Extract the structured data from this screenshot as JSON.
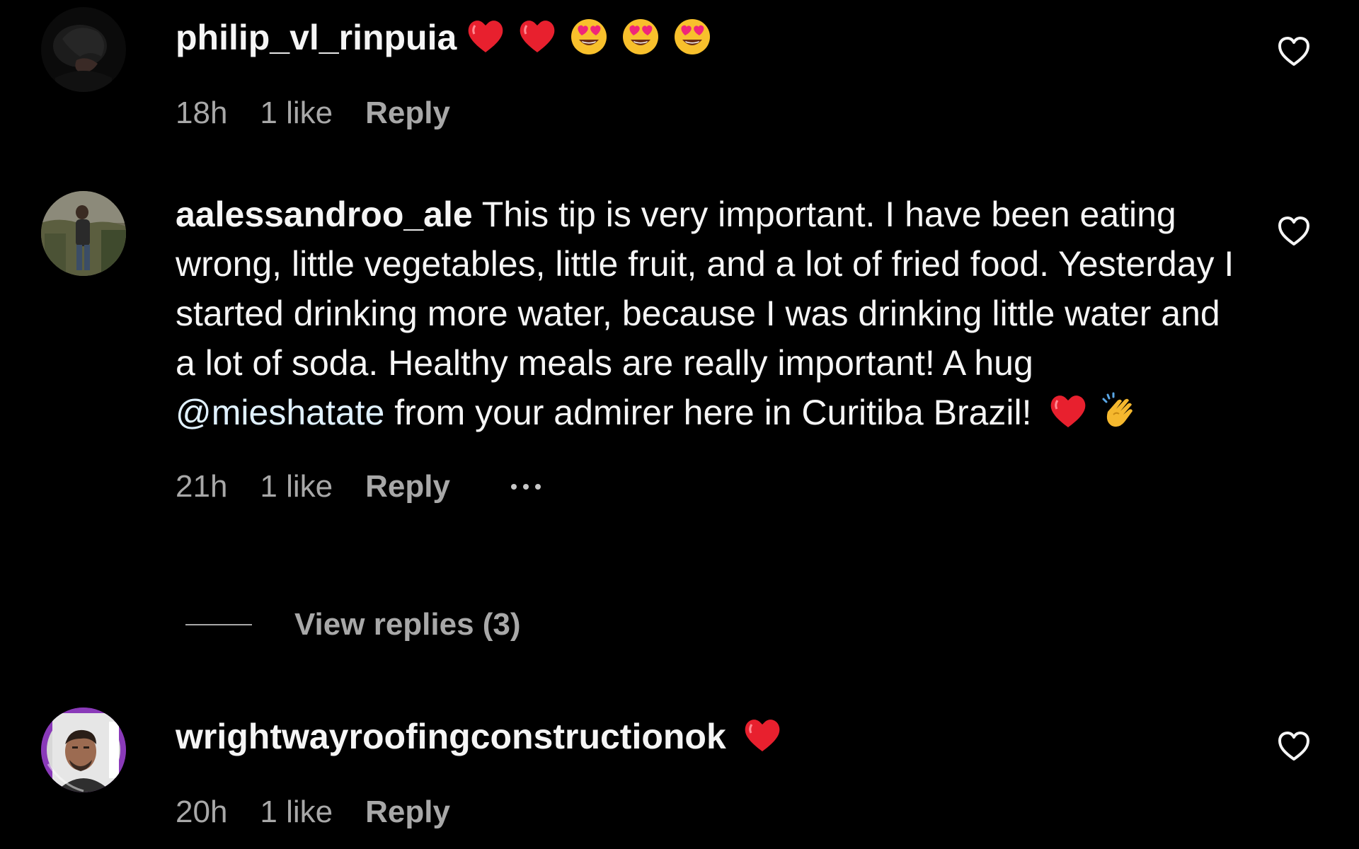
{
  "comments": [
    {
      "username": "philip_vl_rinpuia",
      "text": "",
      "emojis": [
        "red-heart",
        "red-heart",
        "heart-eyes",
        "heart-eyes",
        "heart-eyes"
      ],
      "time": "18h",
      "likes": "1 like",
      "reply_label": "Reply",
      "liked": false
    },
    {
      "username": "aalessandroo_ale",
      "text_before_mention": "This tip is very important. I have been eating wrong, little vegetables, little fruit, and a lot of fried food. Yesterday I started drinking more water, because I was drinking little water and a lot of soda. Healthy meals are really important! A hug ",
      "mention": "@mieshatate",
      "text_after_mention": " from your admirer here in Curitiba Brazil!",
      "emojis": [
        "red-heart",
        "clapping-hands"
      ],
      "time": "21h",
      "likes": "1 like",
      "reply_label": "Reply",
      "more_options": "more-options-icon",
      "view_replies": "View replies (3)",
      "liked": false
    },
    {
      "username": "wrightwayroofingconstructionok",
      "text": "",
      "emojis": [
        "red-heart"
      ],
      "time": "20h",
      "likes": "1 like",
      "reply_label": "Reply",
      "liked": false
    }
  ],
  "colors": {
    "background": "#000000",
    "primary_text": "#f5f5f5",
    "secondary_text": "#a8a8a8",
    "mention": "#e0f1ff",
    "story_ring": "#8a3ab9"
  },
  "icons": {
    "like": "heart-outline-icon",
    "more": "more-options-icon"
  }
}
